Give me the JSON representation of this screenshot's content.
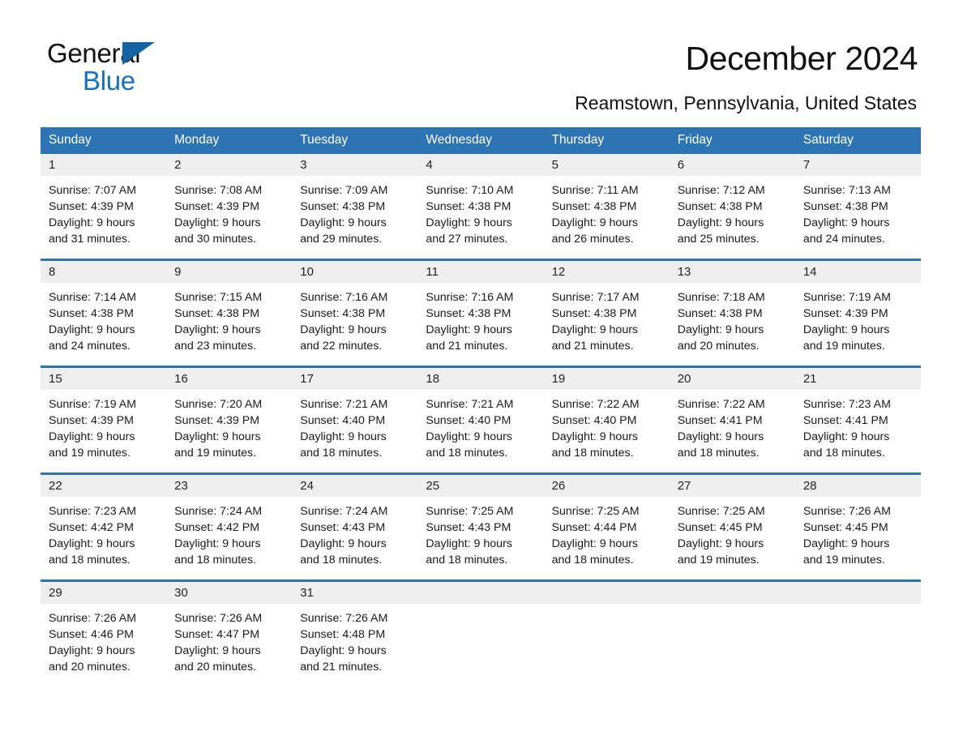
{
  "logo": {
    "word1": "General",
    "word2": "Blue",
    "triangle_color": "#1464a5",
    "blue_text_color": "#1570bf"
  },
  "header": {
    "title": "December 2024",
    "subtitle": "Reamstown, Pennsylvania, United States"
  },
  "theme": {
    "header_blue": "#2d74b5",
    "daynum_band": "#f0f0f0",
    "page_background": "#ffffff",
    "text_color": "#1a1a1a"
  },
  "calendar": {
    "weekday_headers": [
      "Sunday",
      "Monday",
      "Tuesday",
      "Wednesday",
      "Thursday",
      "Friday",
      "Saturday"
    ],
    "labels": {
      "sunrise": "Sunrise:",
      "sunset": "Sunset:",
      "daylight": "Daylight:"
    },
    "weeks": [
      [
        {
          "day": "1",
          "sunrise": "Sunrise: 7:07 AM",
          "sunset": "Sunset: 4:39 PM",
          "daylight_line1": "Daylight: 9 hours",
          "daylight_line2": "and 31 minutes."
        },
        {
          "day": "2",
          "sunrise": "Sunrise: 7:08 AM",
          "sunset": "Sunset: 4:39 PM",
          "daylight_line1": "Daylight: 9 hours",
          "daylight_line2": "and 30 minutes."
        },
        {
          "day": "3",
          "sunrise": "Sunrise: 7:09 AM",
          "sunset": "Sunset: 4:38 PM",
          "daylight_line1": "Daylight: 9 hours",
          "daylight_line2": "and 29 minutes."
        },
        {
          "day": "4",
          "sunrise": "Sunrise: 7:10 AM",
          "sunset": "Sunset: 4:38 PM",
          "daylight_line1": "Daylight: 9 hours",
          "daylight_line2": "and 27 minutes."
        },
        {
          "day": "5",
          "sunrise": "Sunrise: 7:11 AM",
          "sunset": "Sunset: 4:38 PM",
          "daylight_line1": "Daylight: 9 hours",
          "daylight_line2": "and 26 minutes."
        },
        {
          "day": "6",
          "sunrise": "Sunrise: 7:12 AM",
          "sunset": "Sunset: 4:38 PM",
          "daylight_line1": "Daylight: 9 hours",
          "daylight_line2": "and 25 minutes."
        },
        {
          "day": "7",
          "sunrise": "Sunrise: 7:13 AM",
          "sunset": "Sunset: 4:38 PM",
          "daylight_line1": "Daylight: 9 hours",
          "daylight_line2": "and 24 minutes."
        }
      ],
      [
        {
          "day": "8",
          "sunrise": "Sunrise: 7:14 AM",
          "sunset": "Sunset: 4:38 PM",
          "daylight_line1": "Daylight: 9 hours",
          "daylight_line2": "and 24 minutes."
        },
        {
          "day": "9",
          "sunrise": "Sunrise: 7:15 AM",
          "sunset": "Sunset: 4:38 PM",
          "daylight_line1": "Daylight: 9 hours",
          "daylight_line2": "and 23 minutes."
        },
        {
          "day": "10",
          "sunrise": "Sunrise: 7:16 AM",
          "sunset": "Sunset: 4:38 PM",
          "daylight_line1": "Daylight: 9 hours",
          "daylight_line2": "and 22 minutes."
        },
        {
          "day": "11",
          "sunrise": "Sunrise: 7:16 AM",
          "sunset": "Sunset: 4:38 PM",
          "daylight_line1": "Daylight: 9 hours",
          "daylight_line2": "and 21 minutes."
        },
        {
          "day": "12",
          "sunrise": "Sunrise: 7:17 AM",
          "sunset": "Sunset: 4:38 PM",
          "daylight_line1": "Daylight: 9 hours",
          "daylight_line2": "and 21 minutes."
        },
        {
          "day": "13",
          "sunrise": "Sunrise: 7:18 AM",
          "sunset": "Sunset: 4:38 PM",
          "daylight_line1": "Daylight: 9 hours",
          "daylight_line2": "and 20 minutes."
        },
        {
          "day": "14",
          "sunrise": "Sunrise: 7:19 AM",
          "sunset": "Sunset: 4:39 PM",
          "daylight_line1": "Daylight: 9 hours",
          "daylight_line2": "and 19 minutes."
        }
      ],
      [
        {
          "day": "15",
          "sunrise": "Sunrise: 7:19 AM",
          "sunset": "Sunset: 4:39 PM",
          "daylight_line1": "Daylight: 9 hours",
          "daylight_line2": "and 19 minutes."
        },
        {
          "day": "16",
          "sunrise": "Sunrise: 7:20 AM",
          "sunset": "Sunset: 4:39 PM",
          "daylight_line1": "Daylight: 9 hours",
          "daylight_line2": "and 19 minutes."
        },
        {
          "day": "17",
          "sunrise": "Sunrise: 7:21 AM",
          "sunset": "Sunset: 4:40 PM",
          "daylight_line1": "Daylight: 9 hours",
          "daylight_line2": "and 18 minutes."
        },
        {
          "day": "18",
          "sunrise": "Sunrise: 7:21 AM",
          "sunset": "Sunset: 4:40 PM",
          "daylight_line1": "Daylight: 9 hours",
          "daylight_line2": "and 18 minutes."
        },
        {
          "day": "19",
          "sunrise": "Sunrise: 7:22 AM",
          "sunset": "Sunset: 4:40 PM",
          "daylight_line1": "Daylight: 9 hours",
          "daylight_line2": "and 18 minutes."
        },
        {
          "day": "20",
          "sunrise": "Sunrise: 7:22 AM",
          "sunset": "Sunset: 4:41 PM",
          "daylight_line1": "Daylight: 9 hours",
          "daylight_line2": "and 18 minutes."
        },
        {
          "day": "21",
          "sunrise": "Sunrise: 7:23 AM",
          "sunset": "Sunset: 4:41 PM",
          "daylight_line1": "Daylight: 9 hours",
          "daylight_line2": "and 18 minutes."
        }
      ],
      [
        {
          "day": "22",
          "sunrise": "Sunrise: 7:23 AM",
          "sunset": "Sunset: 4:42 PM",
          "daylight_line1": "Daylight: 9 hours",
          "daylight_line2": "and 18 minutes."
        },
        {
          "day": "23",
          "sunrise": "Sunrise: 7:24 AM",
          "sunset": "Sunset: 4:42 PM",
          "daylight_line1": "Daylight: 9 hours",
          "daylight_line2": "and 18 minutes."
        },
        {
          "day": "24",
          "sunrise": "Sunrise: 7:24 AM",
          "sunset": "Sunset: 4:43 PM",
          "daylight_line1": "Daylight: 9 hours",
          "daylight_line2": "and 18 minutes."
        },
        {
          "day": "25",
          "sunrise": "Sunrise: 7:25 AM",
          "sunset": "Sunset: 4:43 PM",
          "daylight_line1": "Daylight: 9 hours",
          "daylight_line2": "and 18 minutes."
        },
        {
          "day": "26",
          "sunrise": "Sunrise: 7:25 AM",
          "sunset": "Sunset: 4:44 PM",
          "daylight_line1": "Daylight: 9 hours",
          "daylight_line2": "and 18 minutes."
        },
        {
          "day": "27",
          "sunrise": "Sunrise: 7:25 AM",
          "sunset": "Sunset: 4:45 PM",
          "daylight_line1": "Daylight: 9 hours",
          "daylight_line2": "and 19 minutes."
        },
        {
          "day": "28",
          "sunrise": "Sunrise: 7:26 AM",
          "sunset": "Sunset: 4:45 PM",
          "daylight_line1": "Daylight: 9 hours",
          "daylight_line2": "and 19 minutes."
        }
      ],
      [
        {
          "day": "29",
          "sunrise": "Sunrise: 7:26 AM",
          "sunset": "Sunset: 4:46 PM",
          "daylight_line1": "Daylight: 9 hours",
          "daylight_line2": "and 20 minutes."
        },
        {
          "day": "30",
          "sunrise": "Sunrise: 7:26 AM",
          "sunset": "Sunset: 4:47 PM",
          "daylight_line1": "Daylight: 9 hours",
          "daylight_line2": "and 20 minutes."
        },
        {
          "day": "31",
          "sunrise": "Sunrise: 7:26 AM",
          "sunset": "Sunset: 4:48 PM",
          "daylight_line1": "Daylight: 9 hours",
          "daylight_line2": "and 21 minutes."
        },
        {
          "day": "",
          "sunrise": "",
          "sunset": "",
          "daylight_line1": "",
          "daylight_line2": ""
        },
        {
          "day": "",
          "sunrise": "",
          "sunset": "",
          "daylight_line1": "",
          "daylight_line2": ""
        },
        {
          "day": "",
          "sunrise": "",
          "sunset": "",
          "daylight_line1": "",
          "daylight_line2": ""
        },
        {
          "day": "",
          "sunrise": "",
          "sunset": "",
          "daylight_line1": "",
          "daylight_line2": ""
        }
      ]
    ]
  }
}
